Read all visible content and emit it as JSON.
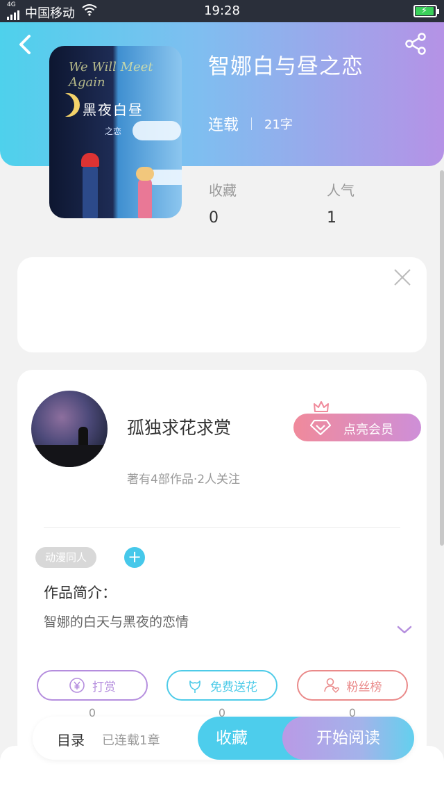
{
  "status_bar": {
    "network": "4G",
    "carrier": "中国移动",
    "time": "19:28"
  },
  "book": {
    "title": "智娜白与昼之恋",
    "status": "连载",
    "word_count": "21字",
    "cover": {
      "script_text": "We Will Meet Again",
      "title": "黑夜白昼",
      "subtitle": "之恋"
    }
  },
  "stats": {
    "favorites_label": "收藏",
    "favorites_value": "0",
    "popularity_label": "人气",
    "popularity_value": "1"
  },
  "author": {
    "name": "孤独求花求赏",
    "meta": "著有4部作品·2人关注",
    "vip_button": "点亮会员"
  },
  "tags": [
    "动漫同人"
  ],
  "tag_add": "+",
  "intro": {
    "label": "作品简介：",
    "text": "智娜的白天与黑夜的恋情"
  },
  "actions": [
    {
      "label": "打赏",
      "count": "0",
      "color": "#b58ede",
      "icon": "yen-icon"
    },
    {
      "label": "免费送花",
      "count": "0",
      "color": "#4ecbe8",
      "icon": "flower-icon"
    },
    {
      "label": "粉丝榜",
      "count": "0",
      "color": "#ea8a8a",
      "icon": "fans-icon"
    }
  ],
  "bottom_bar": {
    "toc_label": "目录",
    "toc_sub": "已连载1章",
    "favorite_button": "收藏",
    "read_button": "开始阅读"
  },
  "colors": {
    "header_gradient_start": "#4ed1ec",
    "header_gradient_end": "#b592e6",
    "accent_cyan": "#4dcdec",
    "accent_purple": "#b99ae6"
  }
}
